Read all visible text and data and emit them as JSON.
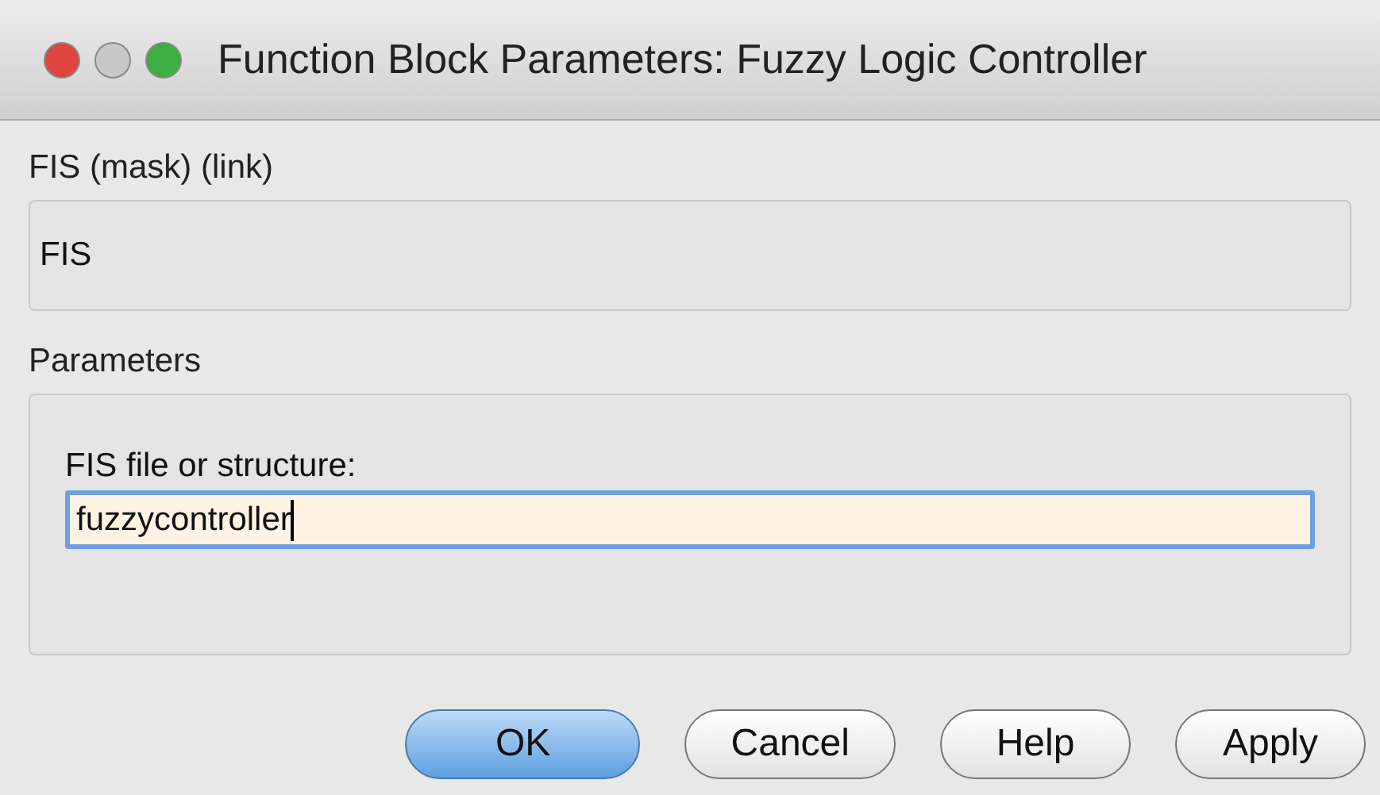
{
  "window": {
    "title": "Function Block Parameters: Fuzzy Logic Controller"
  },
  "mask_section": {
    "heading": "FIS (mask) (link)",
    "description": "FIS"
  },
  "parameters_section": {
    "heading": "Parameters",
    "field": {
      "label": "FIS file or structure:",
      "value": "fuzzycontroller",
      "focused": true
    }
  },
  "buttons": [
    {
      "label": "OK",
      "default": true
    },
    {
      "label": "Cancel",
      "default": false
    },
    {
      "label": "Help",
      "default": false
    },
    {
      "label": "Apply",
      "default": false
    }
  ]
}
